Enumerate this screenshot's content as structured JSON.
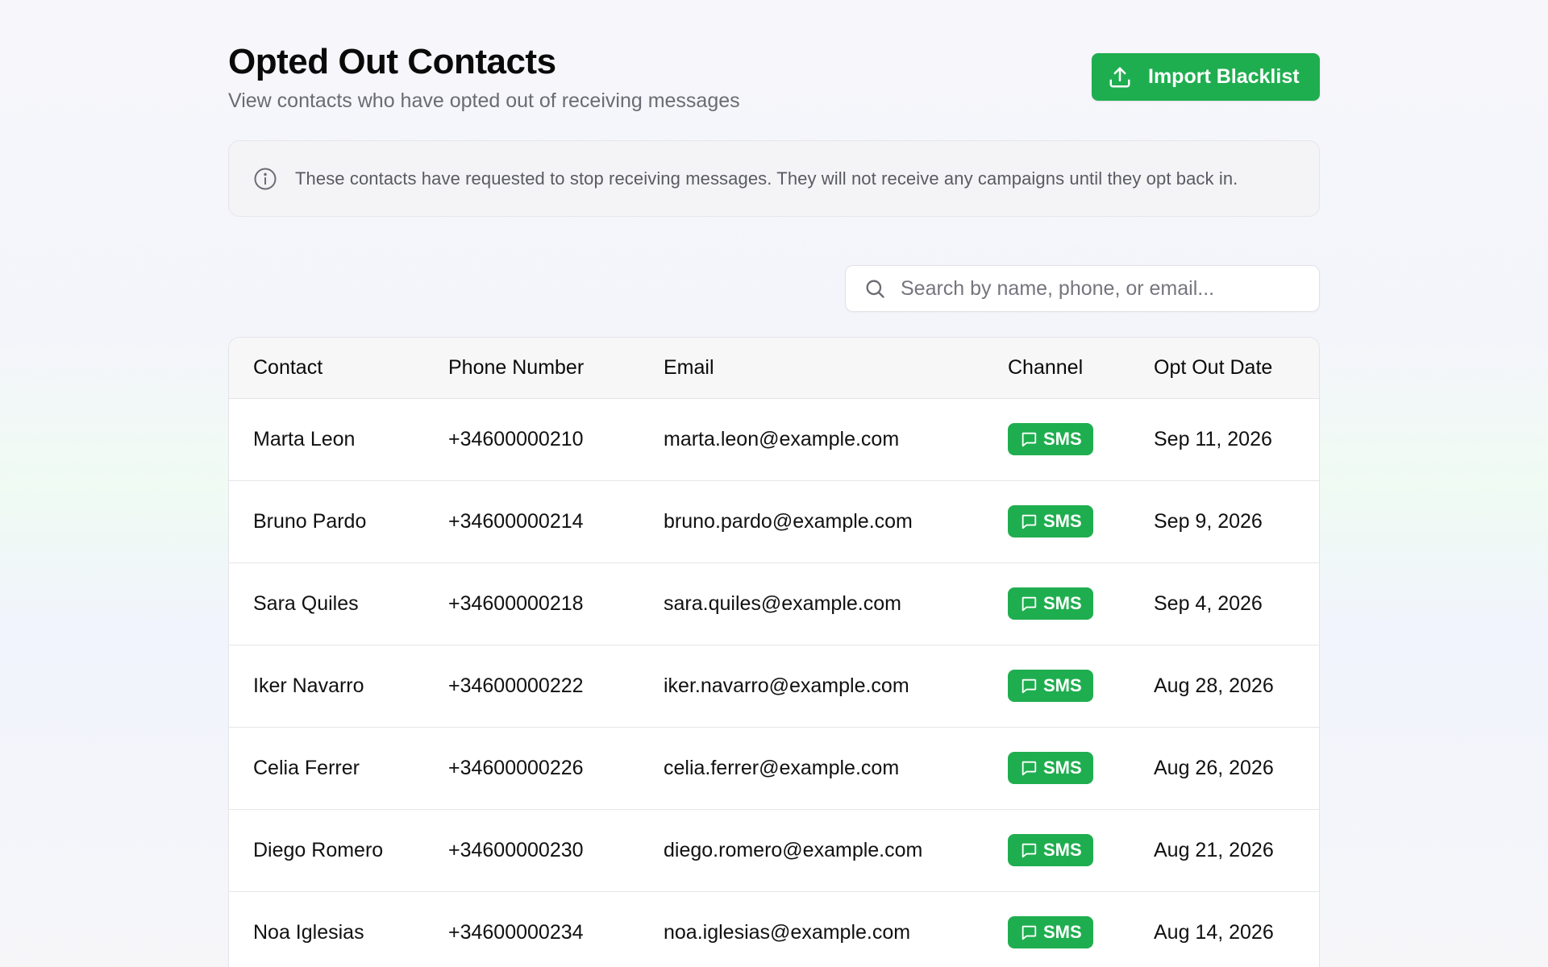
{
  "header": {
    "title": "Opted Out Contacts",
    "subtitle": "View contacts who have opted out of receiving messages",
    "import_button": "Import Blacklist"
  },
  "notice": {
    "icon": "info-icon",
    "text": "These contacts have requested to stop receiving messages. They will not receive any campaigns until they opt back in."
  },
  "search": {
    "placeholder": "Search by name, phone, or email...",
    "value": ""
  },
  "table": {
    "columns": [
      "Contact",
      "Phone Number",
      "Email",
      "Channel",
      "Opt Out Date"
    ],
    "rows": [
      {
        "contact": "Marta Leon",
        "phone": "+34600000210",
        "email": "marta.leon@example.com",
        "channel": "SMS",
        "date": "Sep 11, 2026"
      },
      {
        "contact": "Bruno Pardo",
        "phone": "+34600000214",
        "email": "bruno.pardo@example.com",
        "channel": "SMS",
        "date": "Sep 9, 2026"
      },
      {
        "contact": "Sara Quiles",
        "phone": "+34600000218",
        "email": "sara.quiles@example.com",
        "channel": "SMS",
        "date": "Sep 4, 2026"
      },
      {
        "contact": "Iker Navarro",
        "phone": "+34600000222",
        "email": "iker.navarro@example.com",
        "channel": "SMS",
        "date": "Aug 28, 2026"
      },
      {
        "contact": "Celia Ferrer",
        "phone": "+34600000226",
        "email": "celia.ferrer@example.com",
        "channel": "SMS",
        "date": "Aug 26, 2026"
      },
      {
        "contact": "Diego Romero",
        "phone": "+34600000230",
        "email": "diego.romero@example.com",
        "channel": "SMS",
        "date": "Aug 21, 2026"
      },
      {
        "contact": "Noa Iglesias",
        "phone": "+34600000234",
        "email": "noa.iglesias@example.com",
        "channel": "SMS",
        "date": "Aug 14, 2026"
      }
    ]
  },
  "colors": {
    "accent": "#1fae4f",
    "text": "#0a0a0a",
    "muted": "#6b6b73"
  }
}
